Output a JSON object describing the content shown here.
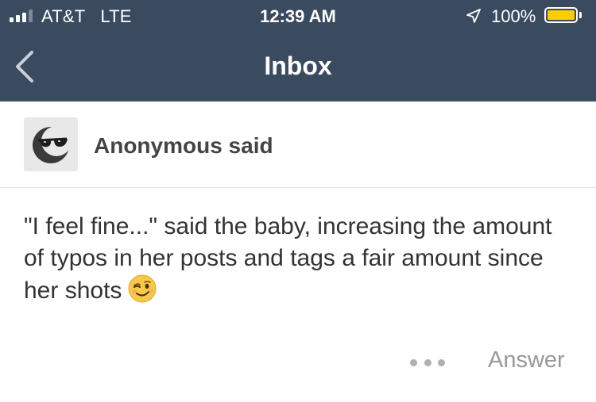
{
  "status_bar": {
    "carrier": "AT&T",
    "network": "LTE",
    "time": "12:39 AM",
    "battery_percent": "100%",
    "signal_bars_filled": 3,
    "signal_bars_total": 4,
    "battery_fill_color": "#ffcc00"
  },
  "nav": {
    "title": "Inbox",
    "back_icon": "chevron-left-icon",
    "background_color": "#3a4a5f"
  },
  "message": {
    "asker": "Anonymous said",
    "avatar_icon": "sunglasses-face-icon",
    "question": "\"I feel fine...\" said the baby, increasing the amount of typos in her posts and tags a fair amount since her shots",
    "emoji": "winking-face-emoji",
    "more_icon": "more-dots-icon",
    "answer_label": "Answer"
  }
}
